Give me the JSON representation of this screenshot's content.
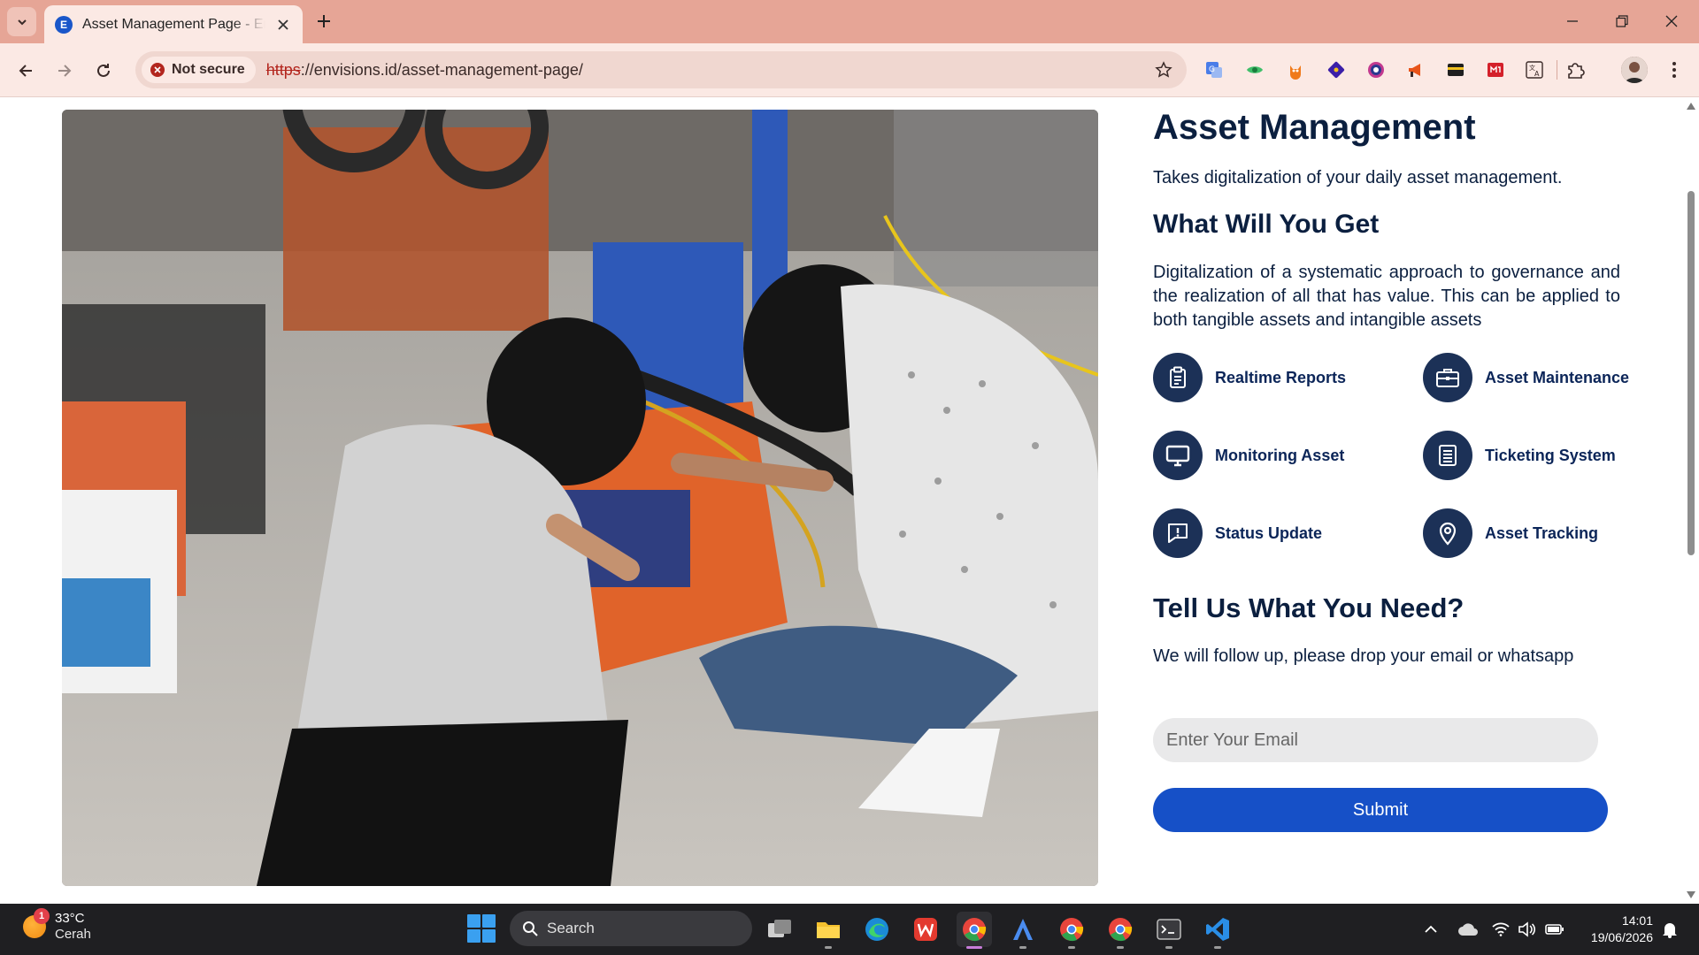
{
  "browser": {
    "tab_title": "Asset Management Page - Envisions",
    "tab_favicon_letter": "E",
    "security_label": "Not secure",
    "url_scheme": "https",
    "url_rest": "://envisions.id/asset-management-page/"
  },
  "page": {
    "title": "Asset Management",
    "lead": "Takes digitalization of your daily asset management.",
    "section_title": "What Will You Get",
    "description": "Digitalization of a systematic approach to governance and the realization of all that has value. This can be applied to both tangible assets and intangible assets",
    "features": [
      {
        "label": "Realtime Reports",
        "icon": "clipboard-icon"
      },
      {
        "label": "Asset Maintenance",
        "icon": "briefcase-icon"
      },
      {
        "label": "Monitoring Asset",
        "icon": "monitor-icon"
      },
      {
        "label": "Ticketing System",
        "icon": "list-icon"
      },
      {
        "label": "Status Update",
        "icon": "message-alert-icon"
      },
      {
        "label": "Asset Tracking",
        "icon": "map-pin-icon"
      }
    ],
    "cta_title": "Tell Us What You Need?",
    "cta_text": "We will follow up, please drop your email or whatsapp",
    "email_placeholder": "Enter Your Email",
    "email_value": "",
    "submit_label": "Submit"
  },
  "taskbar": {
    "weather_temp": "33°C",
    "weather_condition": "Cerah",
    "weather_badge": "1",
    "search_label": "Search",
    "time": "14:01",
    "date": "19/06/2026"
  },
  "colors": {
    "tab_bar": "#e6a596",
    "toolbar": "#fbe9e4",
    "heading": "#0b1f3f",
    "feature_icon_bg": "#1c3157",
    "submit_bg": "#1650c7",
    "taskbar": "#1f1f22"
  }
}
